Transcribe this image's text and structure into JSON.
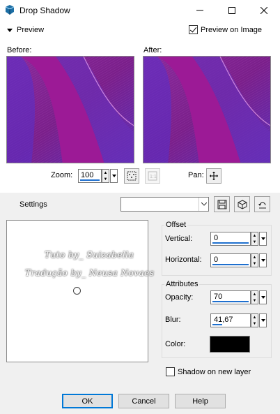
{
  "window": {
    "title": "Drop Shadow"
  },
  "preview": {
    "toggle_label": "Preview",
    "preview_on_image_label": "Preview on Image",
    "preview_on_image_checked": true,
    "before_label": "Before:",
    "after_label": "After:"
  },
  "zoom": {
    "label": "Zoom:",
    "value": "100"
  },
  "pan": {
    "label": "Pan:"
  },
  "settings": {
    "label": "Settings",
    "selected": ""
  },
  "canvas": {
    "watermark_line1": "Tuto by_ Suizabella",
    "watermark_line2": "Tradução by_ Neusa Novaes"
  },
  "offset": {
    "title": "Offset",
    "vertical_label": "Vertical:",
    "vertical_value": "0",
    "horizontal_label": "Horizontal:",
    "horizontal_value": "0"
  },
  "attributes": {
    "title": "Attributes",
    "opacity_label": "Opacity:",
    "opacity_value": "70",
    "blur_label": "Blur:",
    "blur_value": "41,67",
    "color_label": "Color:",
    "color_value": "#000000"
  },
  "shadow_new_layer": {
    "label": "Shadow on new layer",
    "checked": false
  },
  "buttons": {
    "ok": "OK",
    "cancel": "Cancel",
    "help": "Help"
  },
  "colors": {
    "accent": "#1e6fce",
    "preview_purple": "#7a1f8a",
    "preview_magenta": "#a2189e",
    "preview_violet": "#6a2fd0"
  }
}
